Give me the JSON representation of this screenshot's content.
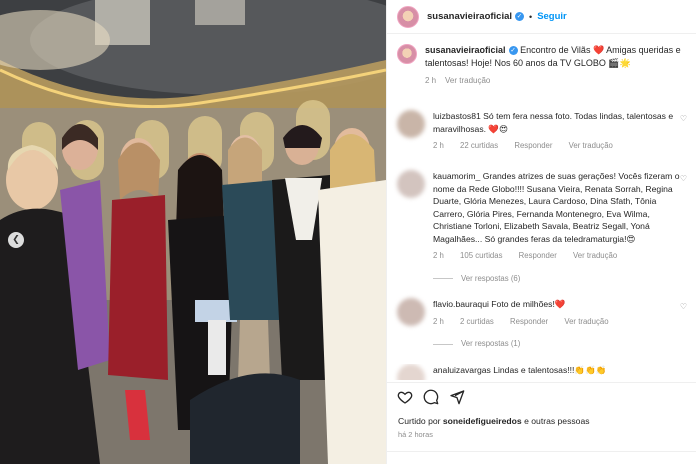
{
  "post": {
    "username": "susanavieiraoficial",
    "follow_label": "Seguir",
    "dot": "•",
    "caption_user": "susanavieiraoficial",
    "caption_text": "Encontro de Vilãs ❤️ Amigas queridas e talentosas! Hoje! Nos 60 anos da TV GLOBO 🎬🌟",
    "caption_age": "2 h",
    "caption_translate": "Ver tradução"
  },
  "comments": [
    {
      "user": "luizbastos81",
      "text": "Só tem fera nessa foto. Todas lindas, talentosas e maravilhosas. ❤️😍",
      "age": "2 h",
      "likes": "22 curtidas",
      "reply": "Responder",
      "translate": "Ver tradução",
      "replies": ""
    },
    {
      "user": "kauamorim_",
      "text": "Grandes atrizes de suas gerações! Vocês fizeram o nome da Rede Globo!!!! Susana Vieira, Renata Sorrah, Regina Duarte, Glória Menezes, Laura Cardoso, Dina Sfath, Tônia Carrero, Glória Pires, Fernanda Montenegro, Eva Wilma, Christiane Torloni, Elizabeth Savala, Beatriz Segall, Yoná Magalhães... Só grandes feras da teledramaturgia!😍",
      "age": "2 h",
      "likes": "105 curtidas",
      "reply": "Responder",
      "translate": "Ver tradução",
      "replies": "Ver respostas (6)"
    },
    {
      "user": "flavio.bauraqui",
      "text": "Foto de milhões!❤️",
      "age": "2 h",
      "likes": "2 curtidas",
      "reply": "Responder",
      "translate": "Ver tradução",
      "replies": "Ver respostas (1)"
    },
    {
      "user": "analuizavargas",
      "text": "Lindas e talentosas!!!👏👏👏",
      "age": "",
      "likes": "",
      "reply": "",
      "translate": "",
      "replies": ""
    }
  ],
  "footer": {
    "liked_prefix": "Curtido por ",
    "liked_user": "soneidefigueiredos",
    "liked_suffix": " e outras pessoas",
    "age": "há 2 horas"
  },
  "icons": {
    "heart": "heart-icon",
    "comment": "comment-icon",
    "share": "share-icon",
    "prev": "chevron-left-icon"
  },
  "colors": {
    "accent": "#0095f6",
    "verified": "#3897f0",
    "muted": "#8e8e8e"
  }
}
